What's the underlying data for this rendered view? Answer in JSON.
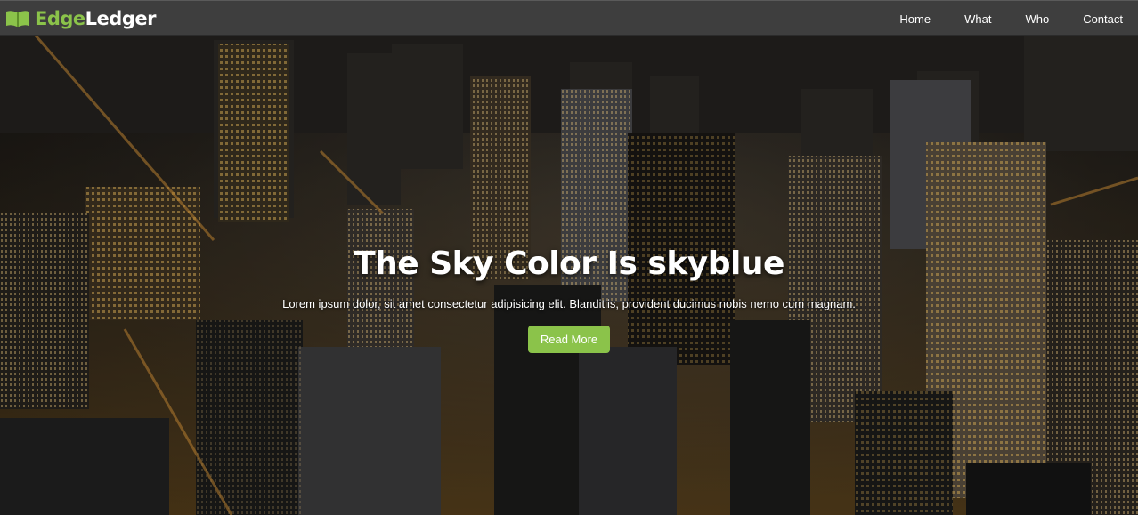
{
  "brand": {
    "name_part1": "Edge",
    "name_part2": "Ledger",
    "icon": "book-icon",
    "accent_color": "#8bc34a"
  },
  "nav": {
    "items": [
      {
        "label": "Home"
      },
      {
        "label": "What"
      },
      {
        "label": "Who"
      },
      {
        "label": "Contact"
      }
    ]
  },
  "hero": {
    "background": "city-night-aerial-image",
    "title": "The Sky Color Is skyblue",
    "text": "Lorem ipsum dolor, sit amet consectetur adipisicing elit. Blanditiis, provident ducimus nobis nemo cum magnam.",
    "button_label": "Read More"
  }
}
